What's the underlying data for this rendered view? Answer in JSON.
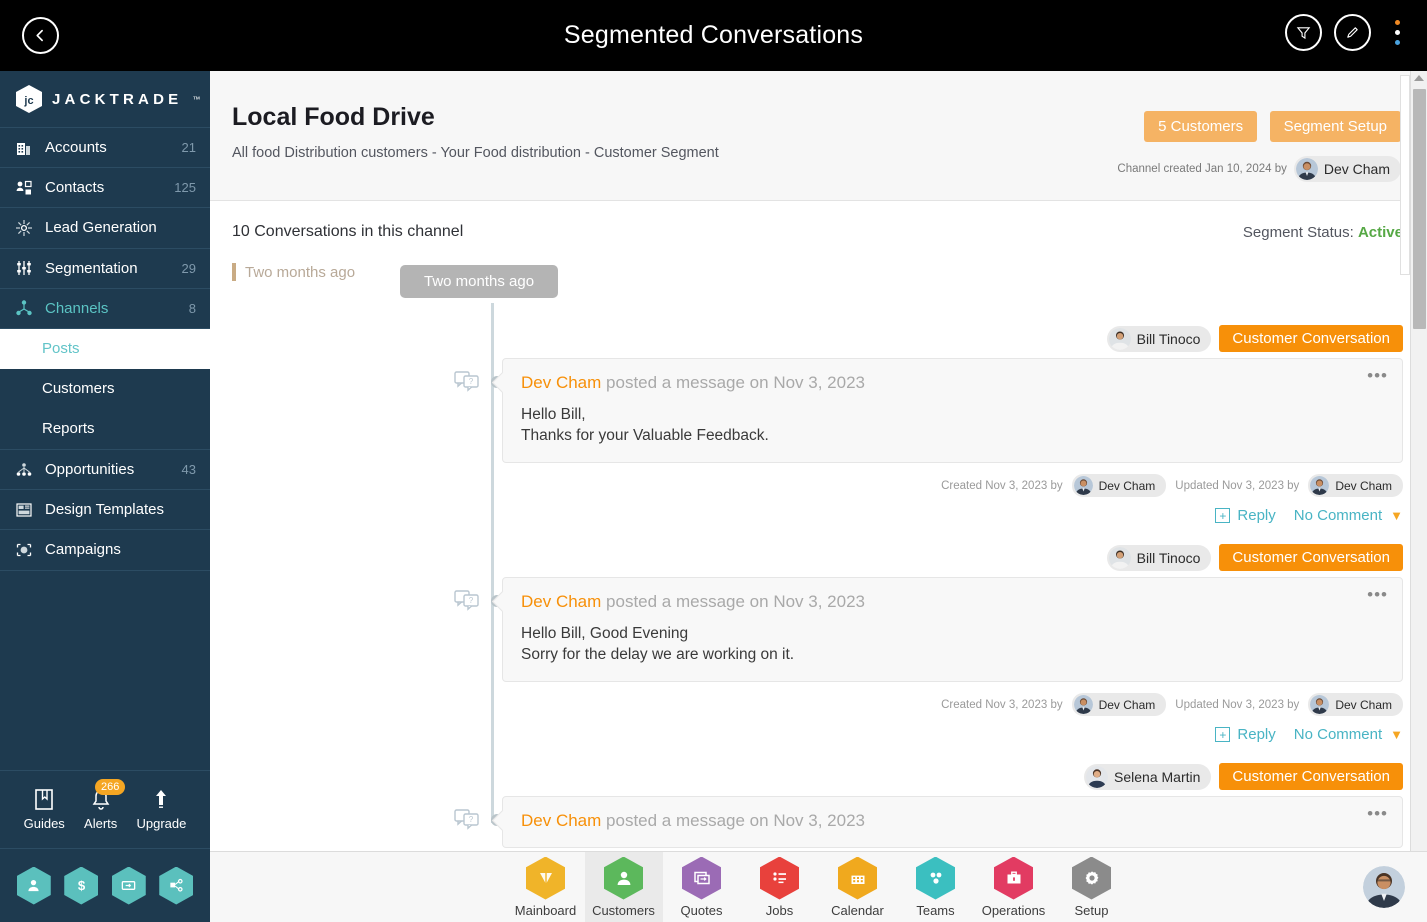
{
  "topbar": {
    "title": "Segmented Conversations",
    "back_icon": "chevron-left-icon",
    "filter_icon": "funnel-icon",
    "edit_icon": "pencil-icon",
    "menu_icon": "kebab-menu-icon"
  },
  "sidebar": {
    "brand": "JACKTRADE",
    "brand_tm": "™",
    "items": [
      {
        "label": "Accounts",
        "count": "21",
        "icon": "building-icon",
        "active": false
      },
      {
        "label": "Contacts",
        "count": "125",
        "icon": "contacts-icon",
        "active": false
      },
      {
        "label": "Lead Generation",
        "count": "",
        "icon": "lead-generation-icon",
        "active": false
      },
      {
        "label": "Segmentation",
        "count": "29",
        "icon": "segmentation-icon",
        "active": false
      },
      {
        "label": "Channels",
        "count": "8",
        "icon": "channels-icon",
        "active": true
      }
    ],
    "sub_items": [
      {
        "label": "Posts",
        "active": true
      },
      {
        "label": "Customers",
        "active": false
      },
      {
        "label": "Reports",
        "active": false
      }
    ],
    "items_after": [
      {
        "label": "Opportunities",
        "count": "43",
        "icon": "opportunities-icon",
        "active": false
      },
      {
        "label": "Design Templates",
        "count": "",
        "icon": "design-templates-icon",
        "active": false
      },
      {
        "label": "Campaigns",
        "count": "",
        "icon": "campaigns-icon",
        "active": false
      }
    ],
    "tools": [
      {
        "label": "Guides",
        "icon": "book-icon",
        "badge": ""
      },
      {
        "label": "Alerts",
        "icon": "bell-icon",
        "badge": "266"
      },
      {
        "label": "Upgrade",
        "icon": "up-arrow-icon",
        "badge": ""
      }
    ],
    "hex_shortcuts": [
      {
        "icon": "person-icon"
      },
      {
        "icon": "dollar-icon"
      },
      {
        "icon": "money-icon"
      },
      {
        "icon": "workflow-icon"
      }
    ],
    "accent_color": "#5bc4c4",
    "bg_color": "#1e3a4f"
  },
  "page": {
    "title": "Local Food Drive",
    "subtitle": "All food Distribution customers - Your Food distribution - Customer Segment",
    "customers_button": "5 Customers",
    "segment_setup_button": "Segment Setup",
    "created_text": "Channel created Jan 10, 2024 by",
    "created_by": "Dev Cham",
    "conversations_count": "10 Conversations in this channel",
    "segment_status_label": "Segment Status:",
    "segment_status_value": "Active",
    "segment_status_color": "#56a845",
    "period_label": "Two months ago",
    "period_pill": "Two months ago"
  },
  "posts": [
    {
      "customer": "Bill Tinoco",
      "tag": "Customer Conversation",
      "author": "Dev Cham",
      "headline_suffix": " posted a message on Nov 3, 2023",
      "body_line1": "Hello Bill,",
      "body_line2": "Thanks for your Valuable Feedback.",
      "created_text": "Created Nov 3, 2023 by",
      "created_by": "Dev Cham",
      "updated_text": "Updated Nov 3, 2023 by",
      "updated_by": "Dev Cham",
      "reply_label": "Reply",
      "comment_label": "No Comment",
      "menu_icon": "ellipsis-icon"
    },
    {
      "customer": "Bill Tinoco",
      "tag": "Customer Conversation",
      "author": "Dev Cham",
      "headline_suffix": " posted a message on Nov 3, 2023",
      "body_line1": "Hello Bill, Good Evening",
      "body_line2": "Sorry for the delay we are working on it.",
      "created_text": "Created Nov 3, 2023 by",
      "created_by": "Dev Cham",
      "updated_text": "Updated Nov 3, 2023 by",
      "updated_by": "Dev Cham",
      "reply_label": "Reply",
      "comment_label": "No Comment",
      "menu_icon": "ellipsis-icon"
    },
    {
      "customer": "Selena Martin",
      "tag": "Customer Conversation",
      "author": "Dev Cham",
      "headline_suffix": " posted a message on Nov 3, 2023",
      "body_line1": "",
      "body_line2": "",
      "created_text": "",
      "created_by": "",
      "updated_text": "",
      "updated_by": "",
      "reply_label": "",
      "comment_label": "",
      "menu_icon": "ellipsis-icon"
    }
  ],
  "bottom_nav": [
    {
      "label": "Mainboard",
      "color": "#f0b429",
      "icon": "mainboard-icon",
      "active": false
    },
    {
      "label": "Customers",
      "color": "#5cb85c",
      "icon": "customers-icon",
      "active": true
    },
    {
      "label": "Quotes",
      "color": "#9b6bb5",
      "icon": "quotes-icon",
      "active": false
    },
    {
      "label": "Jobs",
      "color": "#e8413c",
      "icon": "jobs-icon",
      "active": false
    },
    {
      "label": "Calendar",
      "color": "#f0a91e",
      "icon": "calendar-icon",
      "active": false
    },
    {
      "label": "Teams",
      "color": "#3bbfc0",
      "icon": "teams-icon",
      "active": false
    },
    {
      "label": "Operations",
      "color": "#e23b62",
      "icon": "operations-icon",
      "active": false
    },
    {
      "label": "Setup",
      "color": "#8b8b8b",
      "icon": "setup-icon",
      "active": false
    }
  ],
  "colors": {
    "accent_orange": "#f79009",
    "soft_orange": "#f5b364",
    "teal": "#49b4c4",
    "sidebar": "#1e3a4f"
  }
}
